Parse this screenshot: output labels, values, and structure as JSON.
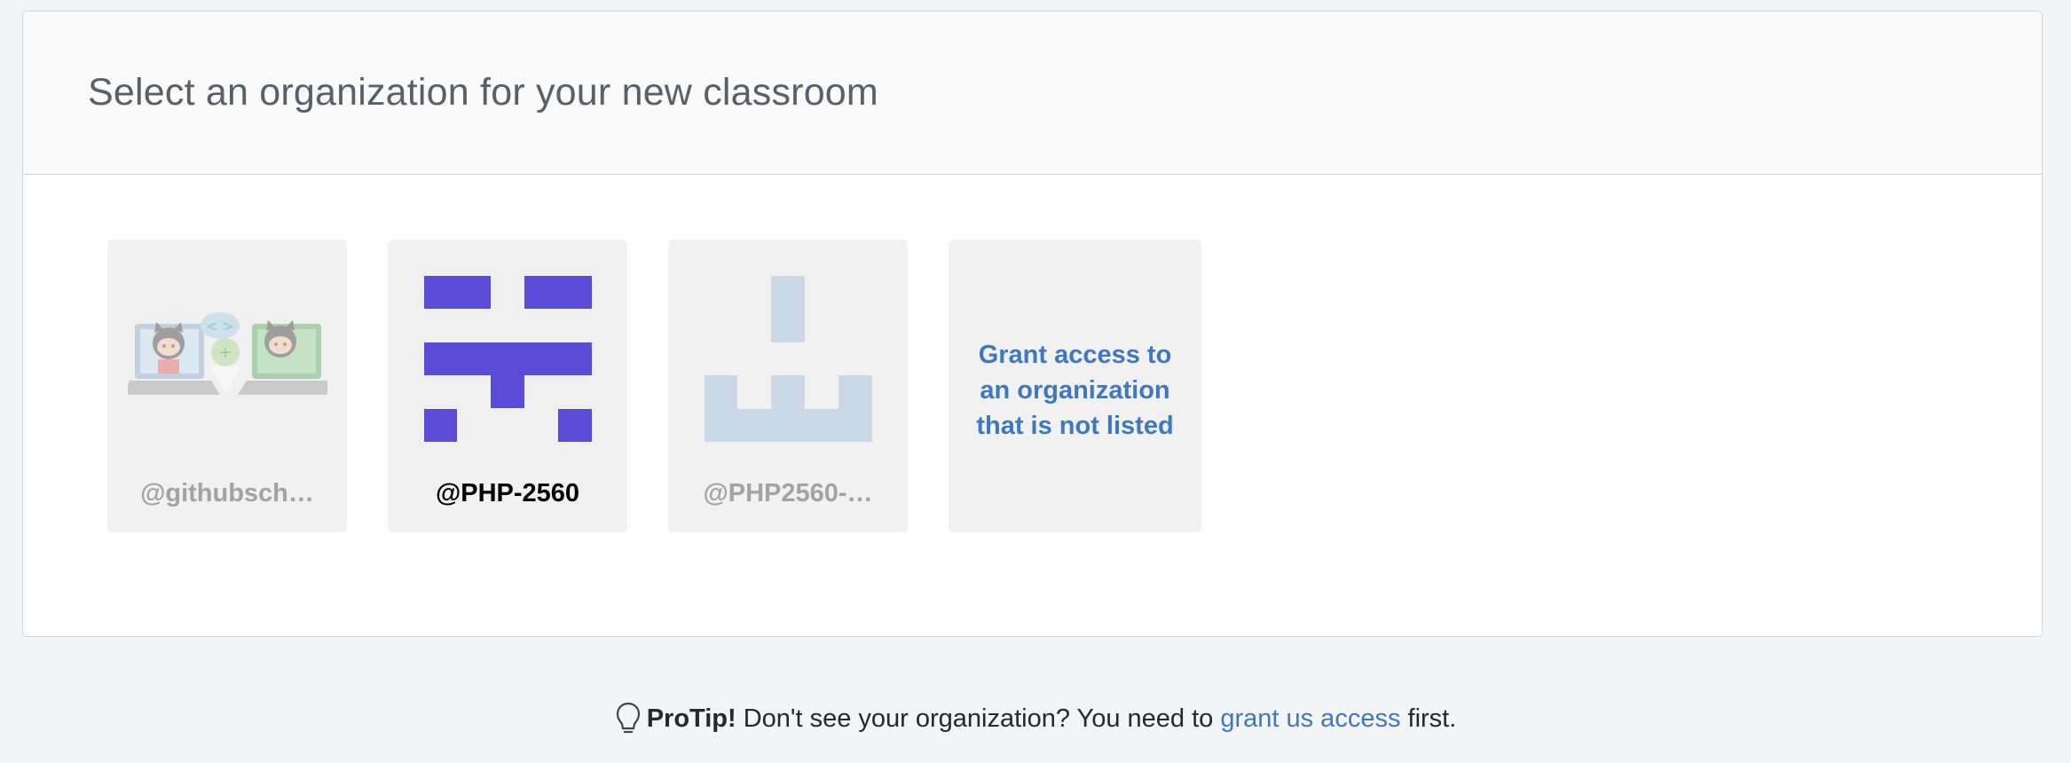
{
  "header": {
    "title": "Select an organization for your new classroom"
  },
  "organizations": [
    {
      "login": "@githubsch…",
      "avatar": "octocat-classroom",
      "state": "disabled"
    },
    {
      "login": "@PHP-2560",
      "avatar": "identicon-purple",
      "state": "enabled",
      "color": "#5b4cd7"
    },
    {
      "login": "@PHP2560-…",
      "avatar": "identicon-lightblue",
      "state": "disabled",
      "color": "#cbd8e6"
    }
  ],
  "grant_card": {
    "label": "Grant access to an organization that is not listed"
  },
  "protip": {
    "icon": "lightbulb-icon",
    "label": "ProTip!",
    "text_before": " Don't see your organization? You need to ",
    "link": "grant us access",
    "text_after": " first."
  },
  "colors": {
    "link": "#4078c0",
    "purple": "#5b4cd7",
    "light_blue": "#cbd8e6"
  }
}
